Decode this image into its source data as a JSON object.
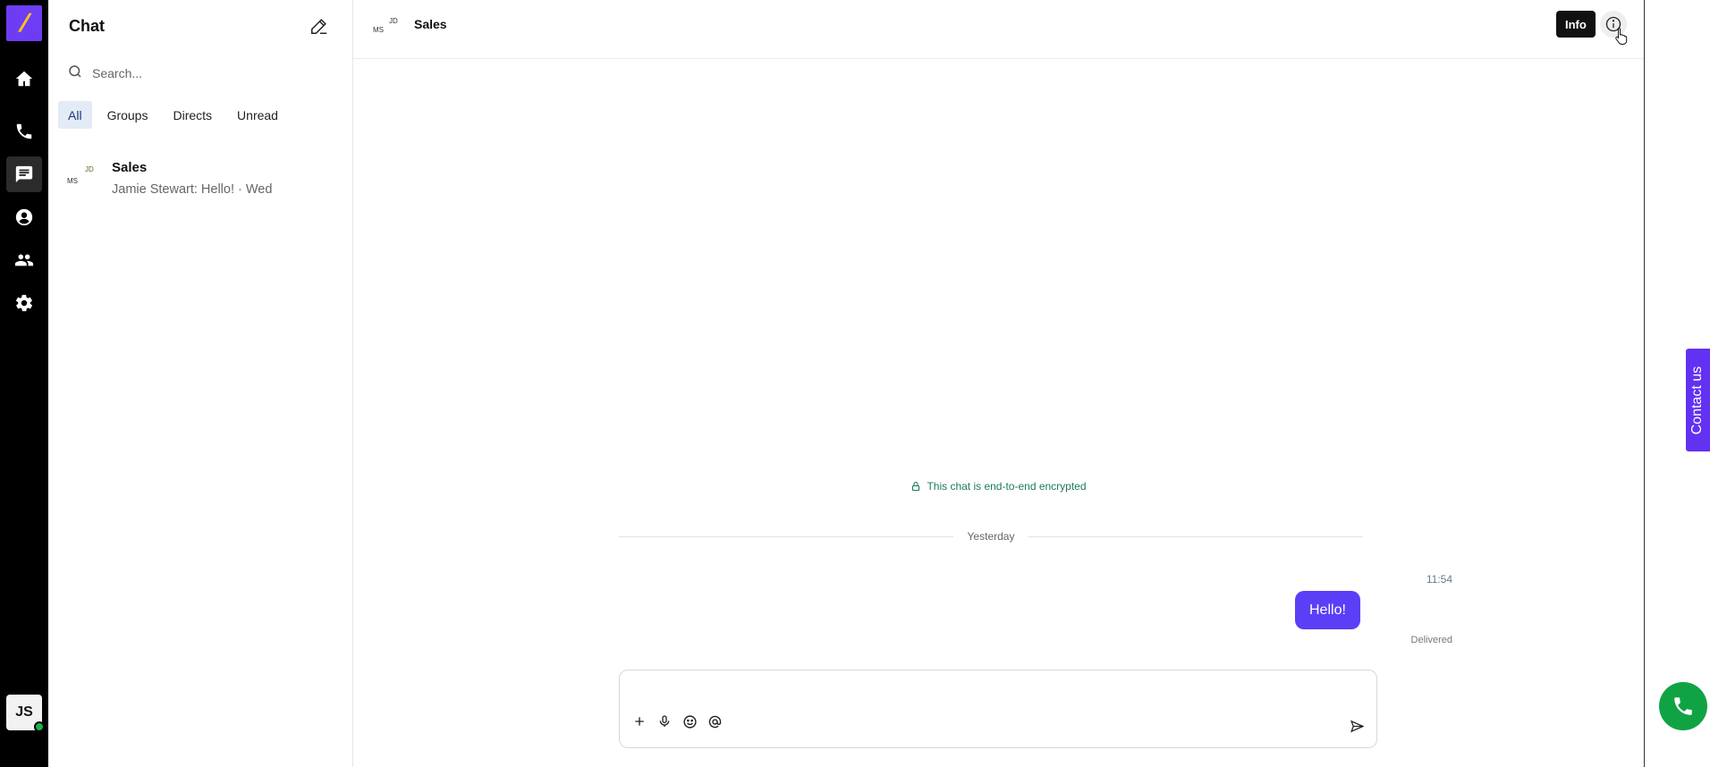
{
  "rail": {
    "logo_glyph": "/",
    "items": [
      {
        "name": "home-icon"
      },
      {
        "name": "phone-icon"
      },
      {
        "name": "chat-icon",
        "active": true
      },
      {
        "name": "contact-icon"
      },
      {
        "name": "people-icon"
      },
      {
        "name": "settings-icon"
      }
    ],
    "user_initials": "JS",
    "status_color": "#1bb24a"
  },
  "list": {
    "title": "Chat",
    "search_placeholder": "Search...",
    "filters": [
      "All",
      "Groups",
      "Directs",
      "Unread"
    ],
    "active_filter": "All",
    "conversations": [
      {
        "avatar_a": "MS",
        "avatar_b": "JD",
        "name": "Sales",
        "preview": "Jamie Stewart: Hello! · Wed"
      }
    ]
  },
  "header": {
    "avatar_a": "MS",
    "avatar_b": "JD",
    "title": "Sales",
    "tooltip": "Info"
  },
  "thread": {
    "encryption_notice": "This chat is end-to-end encrypted",
    "day_divider": "Yesterday",
    "messages": [
      {
        "time": "11:54",
        "text": "Hello!",
        "status": "Delivered"
      }
    ]
  },
  "composer": {
    "tools": [
      "plus-icon",
      "microphone-icon",
      "emoji-icon",
      "mention-icon"
    ]
  },
  "contact_tab": "Contact us",
  "colors": {
    "accent": "#5b3ff6",
    "brand": "#6d3df5",
    "call_green": "#10a344"
  }
}
